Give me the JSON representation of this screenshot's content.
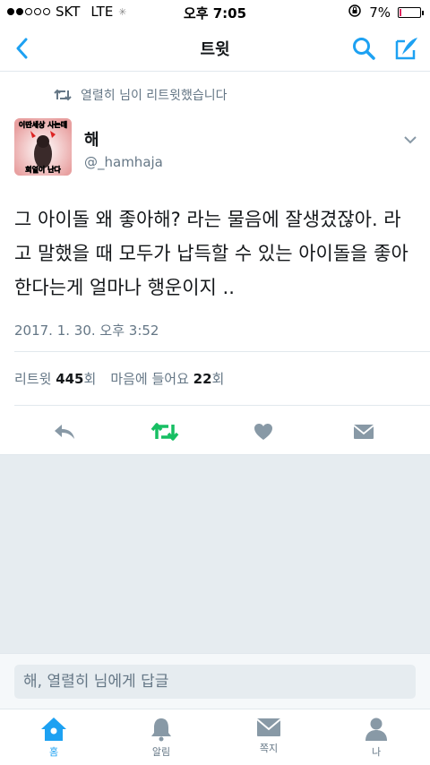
{
  "status_bar": {
    "carrier": "SKT",
    "network": "LTE",
    "time": "오후 7:05",
    "battery": "7%",
    "signal_bars": 2,
    "battery_level": 0.07
  },
  "nav": {
    "title": "트윗",
    "back_icon": "chevron-left-icon",
    "search_icon": "search-icon",
    "compose_icon": "compose-icon"
  },
  "retweet_context": {
    "text": "열렬히 님이 리트윗했습니다",
    "icon": "retweet-icon"
  },
  "tweet": {
    "author_name": "해",
    "author_handle": "@_hamhaja",
    "avatar_text_top": "이딴세상 사는데",
    "avatar_text_bottom": "희열이 난다",
    "text": "그 아이돌 왜 좋아해? 라는 물음에 잘생겼잖아. 라고 말했을 때 모두가 납득할 수 있는 아이돌을 좋아한다는게 얼마나 행운이지 ..",
    "timestamp": "2017. 1. 30. 오후 3:52",
    "retweet_label": "리트윗",
    "retweet_count": "445",
    "count_suffix": "회",
    "like_label": "마음에 들어요",
    "like_count": "22"
  },
  "actions": [
    "reply-icon",
    "retweet-icon",
    "heart-icon",
    "message-icon"
  ],
  "reply": {
    "placeholder": "해, 열렬히 님에게 답글"
  },
  "tabs": [
    {
      "label": "홈",
      "icon": "home-icon",
      "active": true
    },
    {
      "label": "알림",
      "icon": "bell-icon",
      "active": false
    },
    {
      "label": "쪽지",
      "icon": "envelope-icon",
      "active": false
    },
    {
      "label": "나",
      "icon": "person-icon",
      "active": false
    }
  ],
  "colors": {
    "accent": "#1da1f2",
    "retweet": "#17bf63",
    "muted": "#657786",
    "icon_grey": "#8899a6"
  }
}
